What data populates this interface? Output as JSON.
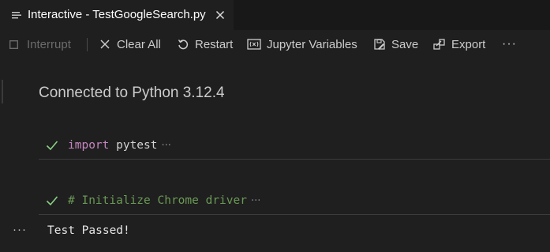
{
  "tab": {
    "title": "Interactive - TestGoogleSearch.py",
    "icon": "list-icon",
    "close_icon": "close-icon"
  },
  "toolbar": {
    "items": [
      {
        "label": "Interrupt",
        "icon": "stop-square-icon",
        "enabled": false
      },
      {
        "label": "Clear All",
        "icon": "close-icon",
        "enabled": true
      },
      {
        "label": "Restart",
        "icon": "restart-icon",
        "enabled": true
      },
      {
        "label": "Jupyter Variables",
        "icon": "variables-icon",
        "enabled": true
      },
      {
        "label": "Save",
        "icon": "save-icon",
        "enabled": true
      },
      {
        "label": "Export",
        "icon": "export-icon",
        "enabled": true
      }
    ],
    "more": "···"
  },
  "content": {
    "status": "Connected to Python 3.12.4",
    "cells": [
      {
        "status_icon": "check-icon",
        "keyword": "import",
        "code": " pytest",
        "fold": "···"
      },
      {
        "status_icon": "check-icon",
        "comment": "# Initialize Chrome driver",
        "fold": "···"
      }
    ],
    "output": {
      "more": "···",
      "text": "Test Passed!"
    }
  },
  "colors": {
    "background": "#1f1f1f",
    "tab_bar": "#181818",
    "keyword": "#c586c0",
    "comment": "#6a9955",
    "success": "#89d185"
  }
}
